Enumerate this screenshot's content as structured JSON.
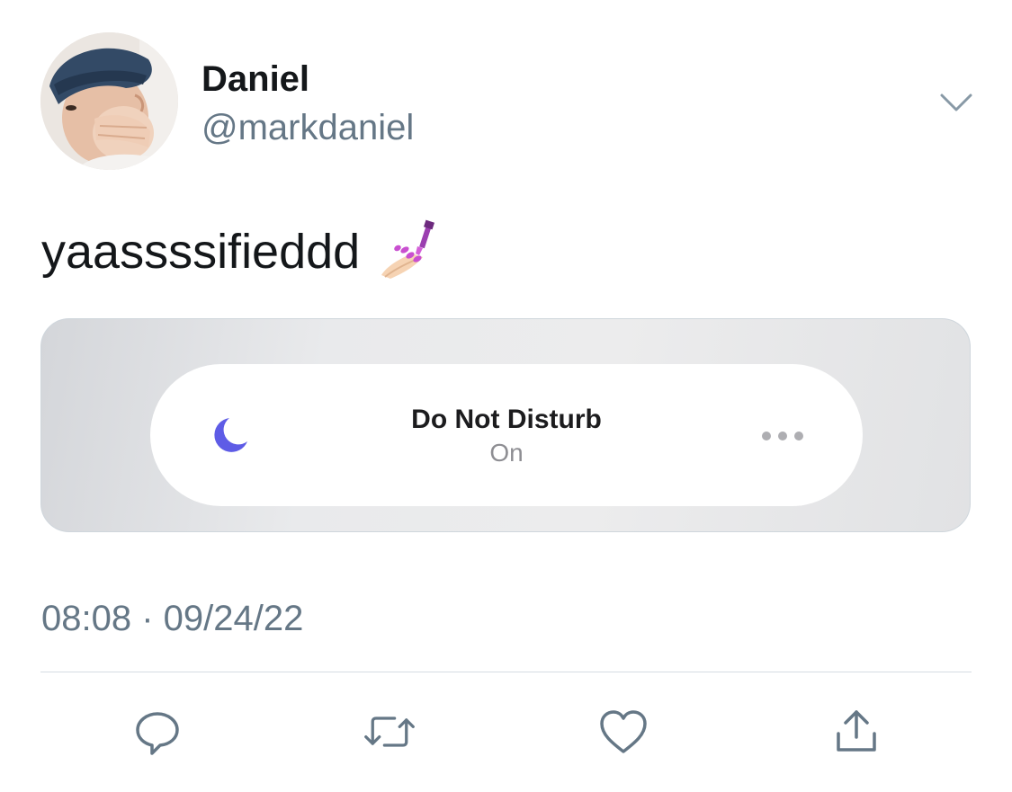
{
  "tweet": {
    "author": {
      "display_name": "Daniel",
      "handle": "@markdaniel"
    },
    "text": "yaassssifieddd",
    "emoji": "nail-polish-emoji",
    "timestamp": "08:08 · 09/24/22"
  },
  "media": {
    "focus_title": "Do Not Disturb",
    "focus_status": "On",
    "moon_color": "#5e5ce6"
  },
  "actions": {
    "icons": [
      "reply-icon",
      "retweet-icon",
      "like-icon",
      "share-icon"
    ]
  },
  "colors": {
    "text_primary": "#14171a",
    "text_secondary": "#657786",
    "icon": "#657786"
  }
}
